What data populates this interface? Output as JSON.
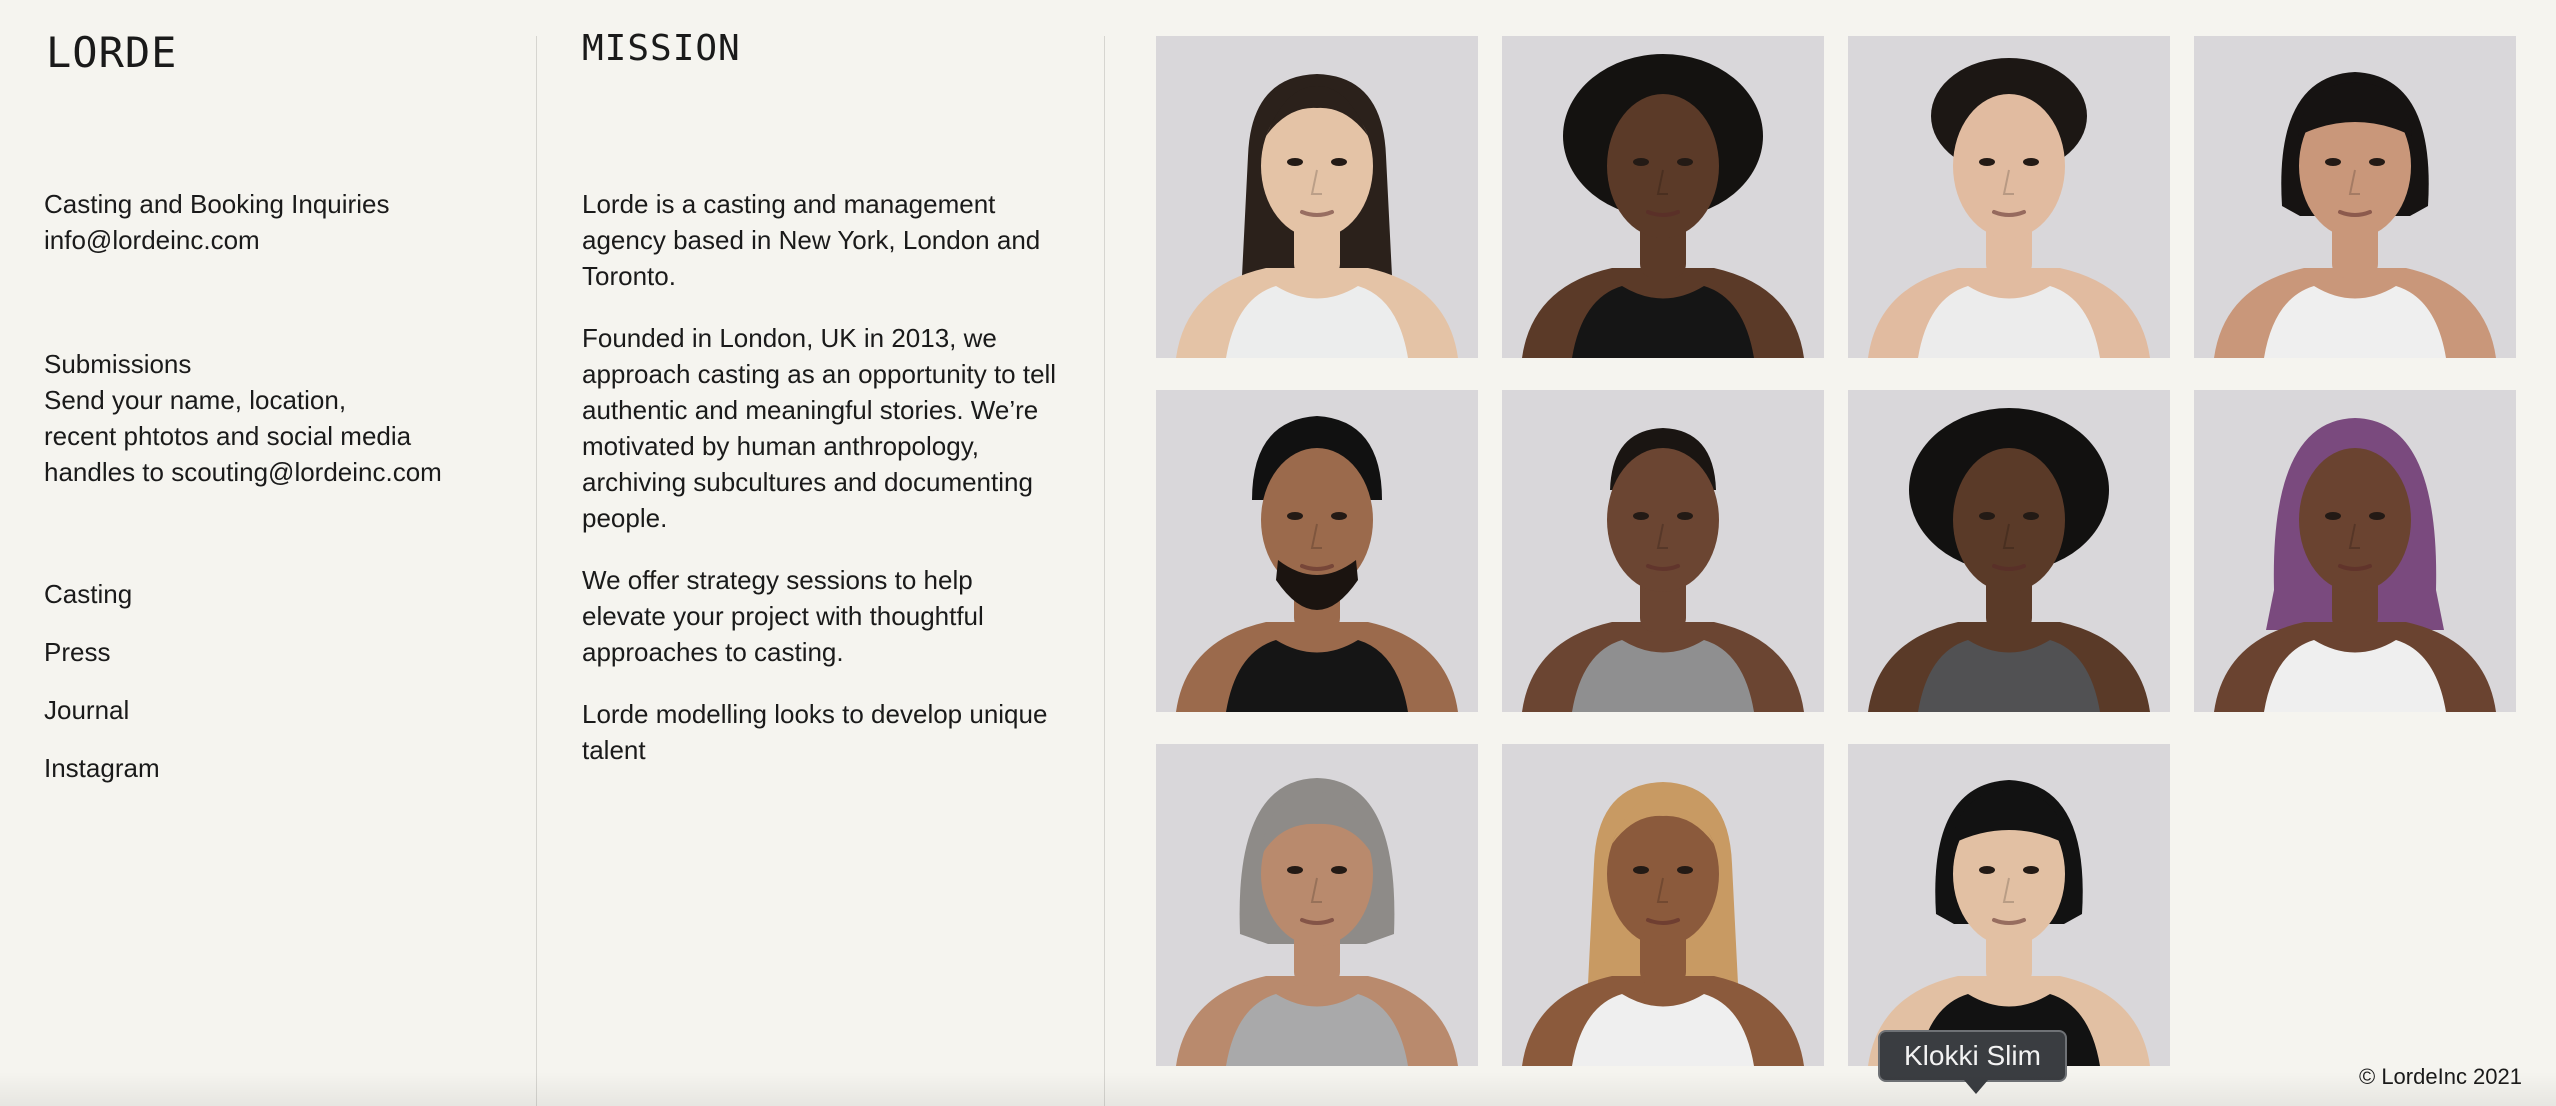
{
  "brand": "LORDE",
  "contact": {
    "casting_heading": "Casting and Booking Inquiries",
    "casting_email": "info@lordeinc.com",
    "submissions_heading": "Submissions",
    "submissions_line1": "Send your name, location,",
    "submissions_line2": "recent phtotos and social media",
    "submissions_line3": "handles to scouting@lordeinc.com"
  },
  "nav": [
    "Casting",
    "Press",
    "Journal",
    "Instagram"
  ],
  "mission": {
    "title": "MISSION",
    "paragraphs": [
      "Lorde is a casting and management agency based in New York, London and Toronto.",
      "Founded in London, UK in 2013, we approach casting as an opportunity to tell authentic and meaningful stories. We’re motivated by human anthropology, archiving subcultures and documenting people.",
      "We offer strategy sessions to help elevate your project with thoughtful approaches to casting.",
      "Lorde modelling looks to develop unique talent"
    ]
  },
  "portraits": [
    {
      "hair": "long-straight",
      "hair_color": "#2b211b",
      "skin": "#e4c3a6",
      "top": "#eceded",
      "alt_name": "portrait-1"
    },
    {
      "hair": "afro",
      "hair_color": "#141210",
      "skin": "#5b3a28",
      "top": "#151515",
      "alt_name": "portrait-2"
    },
    {
      "hair": "short-curly",
      "hair_color": "#1c1714",
      "skin": "#e1bba0",
      "top": "#ececec",
      "alt_name": "portrait-3"
    },
    {
      "hair": "bob-bangs",
      "hair_color": "#161312",
      "skin": "#c9977a",
      "top": "#efefef",
      "alt_name": "portrait-4"
    },
    {
      "hair": "turban",
      "hair_color": "#111111",
      "skin": "#9b6a4c",
      "top": "#151515",
      "alt_name": "portrait-5"
    },
    {
      "hair": "buzz",
      "hair_color": "#1a1512",
      "skin": "#6b4532",
      "top": "#8f8f90",
      "alt_name": "portrait-6"
    },
    {
      "hair": "afro",
      "hair_color": "#121110",
      "skin": "#5a3a28",
      "top": "#515153",
      "alt_name": "portrait-7"
    },
    {
      "hair": "braids",
      "hair_color": "#7a4a7e",
      "skin": "#6a4330",
      "top": "#efefef",
      "alt_name": "portrait-8"
    },
    {
      "hair": "grey-bob",
      "hair_color": "#8e8b88",
      "skin": "#b98a6d",
      "top": "#a9a9aa",
      "alt_name": "portrait-9"
    },
    {
      "hair": "long-blonde",
      "hair_color": "#c89a63",
      "skin": "#8b5a3c",
      "top": "#efefef",
      "alt_name": "portrait-10"
    },
    {
      "hair": "black-bob",
      "hair_color": "#121212",
      "skin": "#e2c0a3",
      "top": "#121212",
      "alt_name": "portrait-11"
    }
  ],
  "tooltip": "Klokki Slim",
  "footer": "© LordeInc 2021"
}
